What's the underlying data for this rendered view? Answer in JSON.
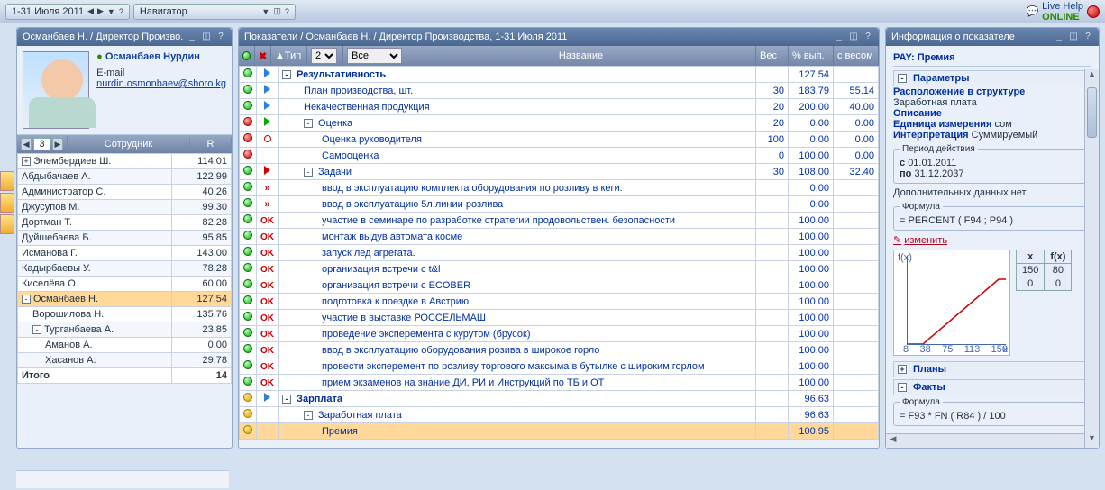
{
  "topbar": {
    "period": "1-31 Июля 2011",
    "navLabel": "Навигатор",
    "liveHelp": "Live Help",
    "online": "ONLINE"
  },
  "leftPanel": {
    "title": "Османбаев Н. / Директор Произво.",
    "nameFull": "Османбаев Нурдин",
    "emailLabel": "E-mail",
    "email": "nurdin.osmonbaev@shoro.kg",
    "page": "3",
    "colEmp": "Сотрудник",
    "colR": "R",
    "employees": [
      {
        "tree": "+",
        "name": "Элембердиев Ш.",
        "r": "114.01"
      },
      {
        "tree": "",
        "name": "Абдыбачаев А.",
        "r": "122.99"
      },
      {
        "tree": "",
        "name": "Администратор С.",
        "r": "40.26"
      },
      {
        "tree": "",
        "name": "Джусупов М.",
        "r": "99.30"
      },
      {
        "tree": "",
        "name": "Дортман Т.",
        "r": "82.28"
      },
      {
        "tree": "",
        "name": "Дуйшебаева Б.",
        "r": "95.85"
      },
      {
        "tree": "",
        "name": "Исманова Г.",
        "r": "143.00"
      },
      {
        "tree": "",
        "name": "Кадырбаевы У.",
        "r": "78.28"
      },
      {
        "tree": "",
        "name": "Киселёва О.",
        "r": "60.00"
      },
      {
        "tree": "-",
        "name": "Османбаев Н.",
        "r": "127.54",
        "sel": true
      },
      {
        "tree": "",
        "name": "Ворошилова Н.",
        "r": "135.76",
        "indent": true
      },
      {
        "tree": "-",
        "name": "Турганбаева А.",
        "r": "23.85",
        "indent": true
      },
      {
        "tree": "",
        "name": "Аманов А.",
        "r": "0.00",
        "indent2": true
      },
      {
        "tree": "",
        "name": "Хасанов А.",
        "r": "29.78",
        "indent2": true
      }
    ],
    "totalLabel": "Итого",
    "totalVal": "14"
  },
  "midPanel": {
    "title": "Показатели / Османбаев Н. / Директор Производства, 1-31 Июля 2011",
    "typeLabel": "Тип",
    "selNum": "2",
    "selAll": "Все",
    "colName": "Название",
    "colWeight": "Вес",
    "colPct": "% вып.",
    "colWeighted": "с весом",
    "rows": [
      {
        "d": "g",
        "i": "play",
        "tree": "-",
        "name": "Результативность",
        "w": "",
        "p": "127.54",
        "v": "",
        "h": true,
        "ind": 0
      },
      {
        "d": "g",
        "i": "play",
        "name": "План производства, шт.",
        "w": "30",
        "p": "183.79",
        "v": "55.14",
        "ind": 1
      },
      {
        "d": "g",
        "i": "play",
        "name": "Некачественная продукция",
        "w": "20",
        "p": "200.00",
        "v": "40.00",
        "ind": 1
      },
      {
        "d": "r",
        "i": "gtri",
        "tree": "-",
        "name": "Оценка",
        "w": "20",
        "p": "0.00",
        "v": "0.00",
        "ind": 1
      },
      {
        "d": "r",
        "i": "rcir",
        "name": "Оценка руководителя",
        "w": "100",
        "p": "0.00",
        "v": "0.00",
        "ind": 2
      },
      {
        "d": "r",
        "i": "",
        "name": "Самооценка",
        "w": "0",
        "p": "100.00",
        "v": "0.00",
        "ind": 2
      },
      {
        "d": "g",
        "i": "rtri",
        "tree": "-",
        "name": "Задачи",
        "w": "30",
        "p": "108.00",
        "v": "32.40",
        "ind": 1
      },
      {
        "d": "g",
        "i": "rdq",
        "name": "ввод в эксплуатацию комплекта оборудования по розливу в кеги.",
        "p": "0.00",
        "ind": 2
      },
      {
        "d": "g",
        "i": "rdq",
        "name": "ввод в эксплуатацию 5л.линии розлива",
        "p": "0.00",
        "ind": 2
      },
      {
        "d": "g",
        "i": "ok",
        "name": "участие в семинаре по разработке стратегии продовольствен. безопасности",
        "p": "100.00",
        "ind": 2
      },
      {
        "d": "g",
        "i": "ok",
        "name": "монтаж выдув автомата косме",
        "p": "100.00",
        "ind": 2
      },
      {
        "d": "g",
        "i": "ok",
        "name": "запуск лед агрегата.",
        "p": "100.00",
        "ind": 2
      },
      {
        "d": "g",
        "i": "ok",
        "name": "организация встречи с t&l",
        "p": "100.00",
        "ind": 2
      },
      {
        "d": "g",
        "i": "ok",
        "name": "организация встречи с ECOBER",
        "p": "100.00",
        "ind": 2
      },
      {
        "d": "g",
        "i": "ok",
        "name": "подготовка к поездке в Австрию",
        "p": "100.00",
        "ind": 2
      },
      {
        "d": "g",
        "i": "ok",
        "name": "участие в выставке РОССЕЛЬМАШ",
        "p": "100.00",
        "ind": 2
      },
      {
        "d": "g",
        "i": "ok",
        "name": "проведение эксперемента с курутом (брусок)",
        "p": "100.00",
        "ind": 2
      },
      {
        "d": "g",
        "i": "ok",
        "name": "ввод в эксплуатацию оборудования розива в широкое горло",
        "p": "100.00",
        "ind": 2
      },
      {
        "d": "g",
        "i": "ok",
        "name": "провести эксперемент по розливу торгового максыма в бутылке с широким горлом",
        "p": "100.00",
        "ind": 2
      },
      {
        "d": "g",
        "i": "ok",
        "name": "прием экзаменов на знание ДИ, РИ и Инструкций по ТБ и ОТ",
        "p": "100.00",
        "ind": 2
      },
      {
        "d": "y",
        "i": "play",
        "tree": "-",
        "name": "Зарплата",
        "p": "96.63",
        "h": true,
        "ind": 0
      },
      {
        "d": "y",
        "i": "",
        "tree": "-",
        "name": "Заработная плата",
        "p": "96.63",
        "ind": 1
      },
      {
        "d": "y",
        "i": "",
        "name": "Премия",
        "p": "100.95",
        "ind": 2,
        "sel": true
      }
    ]
  },
  "rightPanel": {
    "title": "Информация о показателе",
    "payTitle": "PAY: Премия",
    "paramHdr": "Параметры",
    "locLabel": "Расположение в структуре",
    "locVal": "Заработная плата",
    "descLabel": "Описание",
    "unitLabel": "Единица измерения",
    "unitVal": "сом",
    "interpLabel": "Интерпретация",
    "interpVal": "Суммируемый",
    "periodLegend": "Период действия",
    "fromLabel": "с",
    "fromVal": "01.01.2011",
    "toLabel": "по",
    "toVal": "31.12.2037",
    "noExtra": "Дополнительных данных нет.",
    "formulaLegend": "Формула",
    "formula1": "= PERCENT ( F94 ; P94 )",
    "editLabel": "изменить",
    "chartYLabel": "f(x)",
    "chartTicks": [
      "8",
      "38",
      "75",
      "113",
      "150"
    ],
    "tblX": "x",
    "tblFx": "f(x)",
    "tblRows": [
      [
        "150",
        "80"
      ],
      [
        "0",
        "0"
      ]
    ],
    "plansHdr": "Планы",
    "factsHdr": "Факты",
    "formula2": "= F93 * FN ( R84 ) / 100",
    "chart_data": {
      "type": "line",
      "x": [
        0,
        150
      ],
      "y": [
        0,
        80
      ],
      "xlim": [
        8,
        150
      ],
      "xlabel": "x",
      "ylabel": "f(x)"
    }
  },
  "hiddenForm": ""
}
